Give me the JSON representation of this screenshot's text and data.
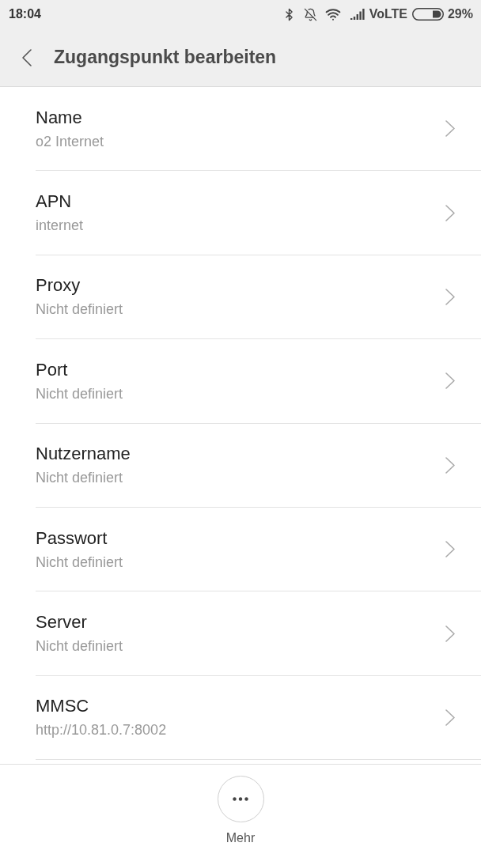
{
  "status_bar": {
    "time": "18:04",
    "network": "VoLTE",
    "battery": "29%"
  },
  "header": {
    "title": "Zugangspunkt bearbeiten"
  },
  "settings": [
    {
      "label": "Name",
      "value": "o2 Internet"
    },
    {
      "label": "APN",
      "value": "internet"
    },
    {
      "label": "Proxy",
      "value": "Nicht definiert"
    },
    {
      "label": "Port",
      "value": "Nicht definiert"
    },
    {
      "label": "Nutzername",
      "value": "Nicht definiert"
    },
    {
      "label": "Passwort",
      "value": "Nicht definiert"
    },
    {
      "label": "Server",
      "value": "Nicht definiert"
    },
    {
      "label": "MMSC",
      "value": "http://10.81.0.7:8002"
    }
  ],
  "bottom_bar": {
    "more_label": "Mehr"
  }
}
